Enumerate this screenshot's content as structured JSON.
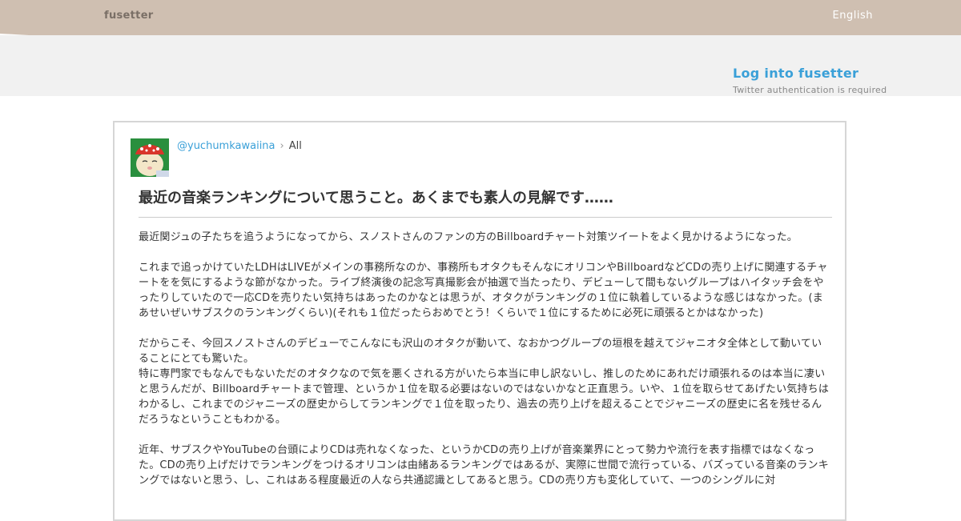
{
  "header": {
    "brand": "fusetter",
    "language": "English",
    "bg_color": "#cfbfb1"
  },
  "login": {
    "link_label": "Log into fusetter",
    "note": "Twitter authentication is required"
  },
  "post": {
    "username": "@yuchumkawaiina",
    "separator": "›",
    "category": "All",
    "title": "最近の音楽ランキングについて思うこと。あくまでも素人の見解です……",
    "paragraphs": [
      "最近関ジュの子たちを追うようになってから、スノストさんのファンの方のBillboardチャート対策ツイートをよく見かけるようになった。",
      "これまで追っかけていたLDHはLIVEがメインの事務所なのか、事務所もオタクもそんなにオリコンやBillboardなどCDの売り上げに関連するチャートをを気にするような節がなかった。ライブ終演後の記念写真撮影会が抽選で当たったり、デビューして間もないグループはハイタッチ会をやったりしていたので一応CDを売りたい気持ちはあったのかなとは思うが、オタクがランキングの１位に執着しているような感じはなかった。(まあせいぜいサブスクのランキングくらい)(それも１位だったらおめでとう！くらいで１位にするために必死に頑張るとかはなかった)",
      "だからこそ、今回スノストさんのデビューでこんなにも沢山のオタクが動いて、なおかつグループの垣根を越えてジャニオタ全体として動いていることにとても驚いた。\n特に専門家でもなんでもないただのオタクなので気を悪くされる方がいたら本当に申し訳ないし、推しのためにあれだけ頑張れるのは本当に凄いと思うんだが、Billboardチャートまで管理、というか１位を取る必要はないのではないかなと正直思う。いや、１位を取らせてあげたい気持ちはわかるし、これまでのジャニーズの歴史からしてランキングで１位を取ったり、過去の売り上げを超えることでジャニーズの歴史に名を残せるんだろうなということもわかる。",
      "近年、サブスクやYouTubeの台頭によりCDは売れなくなった、というかCDの売り上げが音楽業界にとって勢力や流行を表す指標ではなくなった。CDの売り上げだけでランキングをつけるオリコンは由緒あるランキングではあるが、実際に世間で流行っている、バズっている音楽のランキングではないと思う、し、これはある程度最近の人なら共通認識としてあると思う。CDの売り方も変化していて、一つのシングルに対"
    ]
  }
}
